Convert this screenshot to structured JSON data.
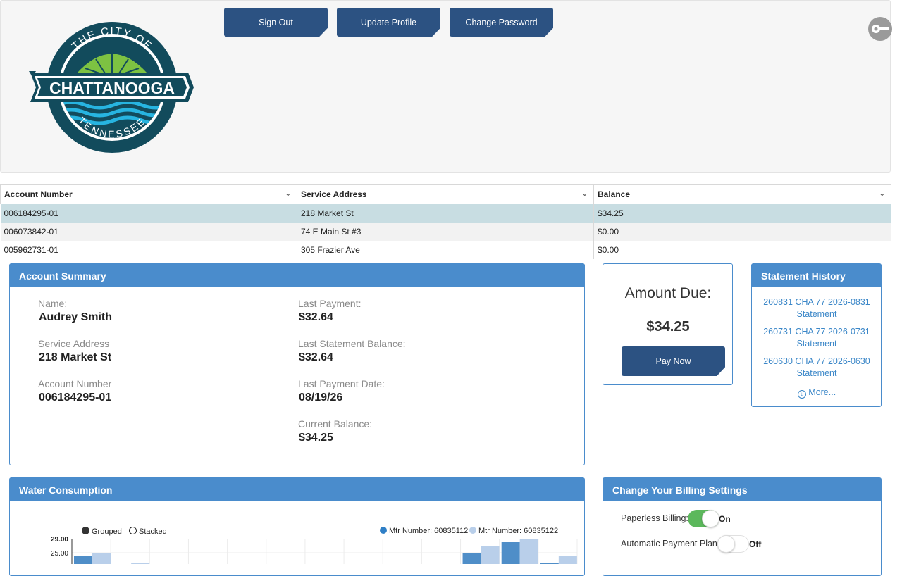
{
  "header": {
    "logo": {
      "top_text": "THE CITY OF",
      "main_text": "CHATTANOOGA",
      "bottom_text": "TENNESSEE"
    },
    "buttons": {
      "sign_out": "Sign Out",
      "update_profile": "Update Profile",
      "change_password": "Change Password"
    },
    "key_icon": "key-icon"
  },
  "accounts_table": {
    "columns": [
      "Account Number",
      "Service Address",
      "Balance"
    ],
    "rows": [
      [
        "006184295-01",
        "218 Market St",
        "$34.25"
      ],
      [
        "006073842-01",
        "74 E Main St #3",
        "$0.00"
      ],
      [
        "005962731-01",
        "305 Frazier Ave",
        "$0.00"
      ]
    ]
  },
  "account_summary": {
    "title": "Account Summary",
    "name_label": "Name:",
    "name": "Audrey Smith",
    "address_label": "Service Address",
    "address": "218 Market St",
    "account_label": "Account Number",
    "account": "006184295-01",
    "last_payment_label": "Last Payment:",
    "last_payment": "$32.64",
    "last_statement_label": "Last Statement Balance:",
    "last_statement": "$32.64",
    "last_payment_date_label": "Last Payment Date:",
    "last_payment_date": "08/19/26",
    "current_balance_label": "Current Balance:",
    "current_balance": "$34.25"
  },
  "amount_due": {
    "title": "Amount Due:",
    "amount": "$34.25",
    "pay_button": "Pay Now"
  },
  "statement_history": {
    "title": "Statement History",
    "items": [
      {
        "line1": "260831 CHA 77 2026-0831",
        "line2": "Statement"
      },
      {
        "line1": "260731 CHA 77 2026-0731",
        "line2": "Statement"
      },
      {
        "line1": "260630 CHA 77 2026-0630",
        "line2": "Statement"
      }
    ],
    "more": "More..."
  },
  "water_consumption": {
    "title": "Water Consumption",
    "mode_grouped": "Grouped",
    "mode_stacked": "Stacked",
    "selected_mode": "Grouped"
  },
  "chart_data": {
    "type": "bar",
    "series": [
      {
        "name": "Mtr Number: 60835112",
        "color": "#4f8ec8",
        "values": [
          24,
          0,
          19,
          0,
          0,
          0,
          0,
          0,
          0,
          0,
          25,
          28,
          22
        ]
      },
      {
        "name": "Mtr Number: 60835122",
        "color": "#b9cfea",
        "values": [
          25,
          22,
          0,
          0,
          0,
          0,
          0,
          0,
          0,
          0,
          27,
          29,
          24
        ]
      }
    ],
    "ytick_labels": [
      "29.00",
      "25.00"
    ],
    "ylim": [
      0,
      29
    ],
    "grid": true,
    "legend_position": "top-right"
  },
  "billing_settings": {
    "title": "Change Your Billing Settings",
    "paperless_label": "Paperless Billing:",
    "paperless_state": "On",
    "autopay_label": "Automatic Payment Plan:",
    "autopay_state": "Off",
    "colors": {
      "on": "#5cb85c",
      "off": "#ffffff"
    }
  }
}
